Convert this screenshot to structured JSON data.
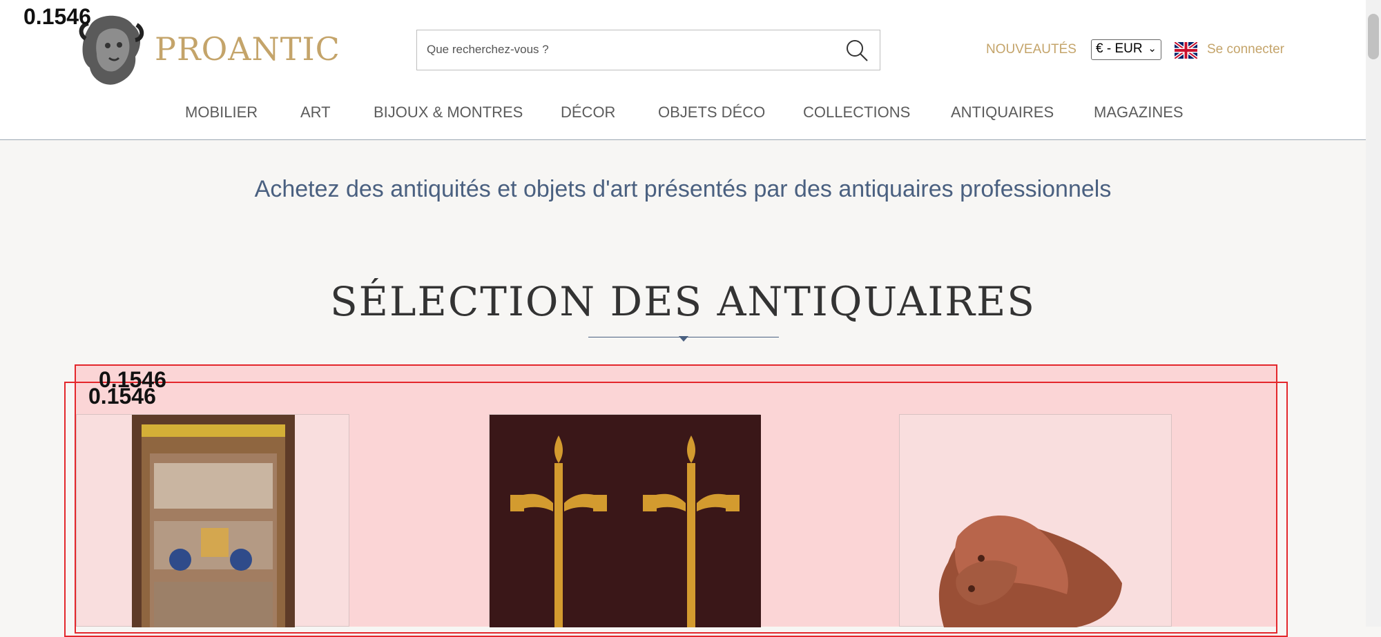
{
  "brand": {
    "name": "PROANTIC",
    "logo_icon": "antique-head-logo"
  },
  "search": {
    "placeholder": "Que recherchez-vous ?",
    "icon": "search-icon"
  },
  "header_links": {
    "new": "NOUVEAUTÉS",
    "currency": "€ - EUR",
    "language_icon": "uk-flag-icon",
    "login": "Se connecter"
  },
  "nav": [
    "MOBILIER",
    "ART",
    "BIJOUX & MONTRES",
    "DÉCOR",
    "OBJETS DÉCO",
    "COLLECTIONS",
    "ANTIQUAIRES",
    "MAGAZINES"
  ],
  "tagline": "Achetez des antiquités et objets d'art présentés par des antiquaires professionnels",
  "section": {
    "title": "SÉLECTION DES ANTIQUAIRES"
  },
  "overlay_scores": [
    "0.1546",
    "0.1546",
    "0.1546"
  ],
  "products": [
    {
      "icon": "vitrine-cabinet-image"
    },
    {
      "icon": "candelabra-pair-image"
    },
    {
      "icon": "lion-sculpture-image"
    }
  ],
  "colors": {
    "accent": "#c4a46a",
    "nav_text": "#5b5b5b",
    "tagline": "#4a6080",
    "overlay_red": "#e3262b",
    "overlay_pink": "#fbd5d6"
  }
}
